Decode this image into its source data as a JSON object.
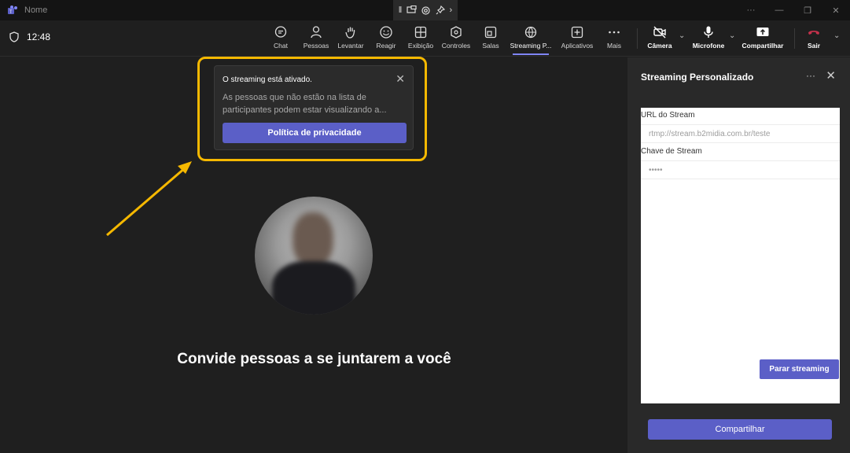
{
  "titlebar": {
    "app_title": "Nome"
  },
  "toolbar": {
    "time": "12:48",
    "items": [
      {
        "label": "Chat",
        "icon": "chat-icon"
      },
      {
        "label": "Pessoas",
        "icon": "people-icon"
      },
      {
        "label": "Levantar",
        "icon": "raise-hand-icon"
      },
      {
        "label": "Reagir",
        "icon": "react-icon"
      },
      {
        "label": "Exibição",
        "icon": "view-icon"
      },
      {
        "label": "Controles",
        "icon": "controls-icon"
      },
      {
        "label": "Salas",
        "icon": "rooms-icon"
      },
      {
        "label": "Streaming P...",
        "icon": "streaming-icon"
      },
      {
        "label": "Aplicativos",
        "icon": "apps-icon"
      },
      {
        "label": "Mais",
        "icon": "more-icon"
      }
    ],
    "camera": "Câmera",
    "microphone": "Microfone",
    "share": "Compartilhar",
    "leave": "Sair"
  },
  "popup": {
    "title": "O streaming está ativado.",
    "body": "As pessoas que não estão na lista de participantes podem estar visualizando a...",
    "button": "Política de privacidade"
  },
  "stage": {
    "invite_text": "Convide pessoas a se juntarem a você"
  },
  "panel": {
    "title": "Streaming Personalizado",
    "url_label": "URL do Stream",
    "url_value": "rtmp://stream.b2midia.com.br/teste",
    "key_label": "Chave de Stream",
    "key_value": "•••••",
    "stop_button": "Parar streaming",
    "share_button": "Compartilhar"
  },
  "colors": {
    "accent": "#5b5fc7",
    "highlight": "#f5b800",
    "background": "#1f1f1f",
    "panel": "#292929",
    "leave_red": "#c4314b"
  }
}
